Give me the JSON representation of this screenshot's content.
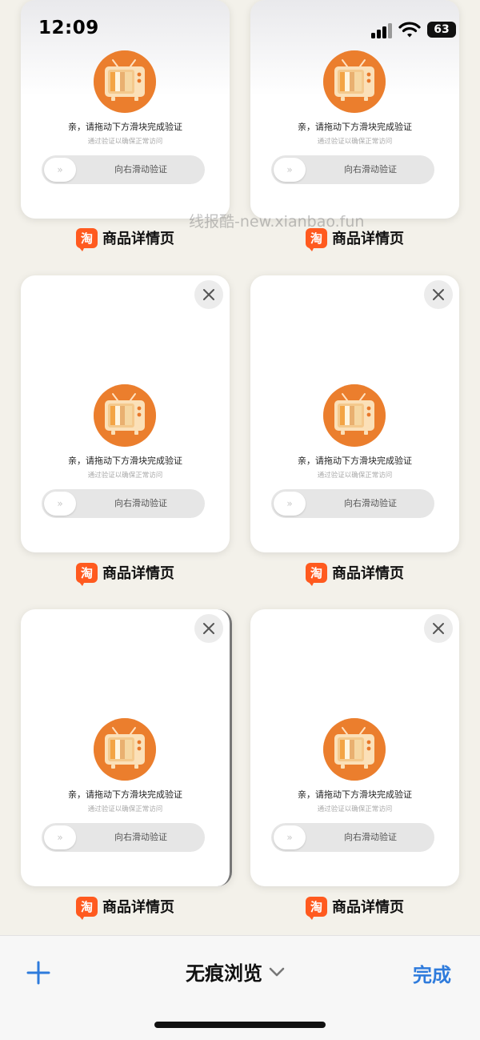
{
  "status_bar": {
    "time": "12:09",
    "battery": "63"
  },
  "watermark": "线报酷-new.xianbao.fun",
  "verify": {
    "title": "亲，请拖动下方滑块完成验证",
    "subtitle": "通过验证以确保正常访问",
    "slider_label": "向右滑动验证",
    "slider_arrows": "»"
  },
  "tabs": [
    {
      "label": "商品详情页",
      "app_icon_text": "淘"
    },
    {
      "label": "商品详情页",
      "app_icon_text": "淘"
    },
    {
      "label": "商品详情页",
      "app_icon_text": "淘"
    },
    {
      "label": "商品详情页",
      "app_icon_text": "淘"
    },
    {
      "label": "商品详情页",
      "app_icon_text": "淘"
    },
    {
      "label": "商品详情页",
      "app_icon_text": "淘"
    }
  ],
  "toolbar": {
    "mode_label": "无痕浏览",
    "done_label": "完成"
  },
  "colors": {
    "accent": "#2e7bdc",
    "taobao_orange": "#ff5a1f",
    "tv_orange": "#e8782a"
  }
}
